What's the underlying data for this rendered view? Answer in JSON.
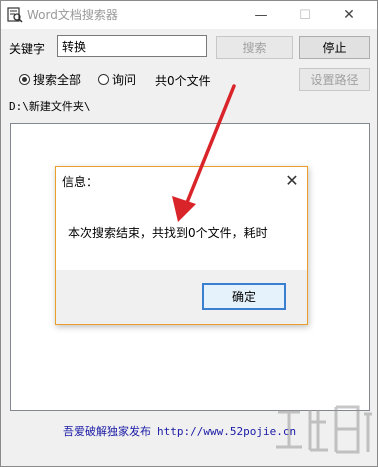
{
  "window": {
    "title": "Word文档搜索器",
    "controls": {
      "minimize": "—",
      "maximize": "☐",
      "close": "✕"
    }
  },
  "search": {
    "keyword_label": "关键字",
    "keyword_value": "转换",
    "search_button": "搜索",
    "stop_button": "停止",
    "set_path_button": "设置路径"
  },
  "options": {
    "search_all": "搜索全部",
    "ask": "询问",
    "selected": "search_all"
  },
  "status": {
    "found_text": "共0个文件",
    "path": "D:\\新建文件夹\\"
  },
  "dialog": {
    "title": "信息：",
    "message": "本次搜索结束，共找到0个文件，耗时",
    "ok_button": "确定"
  },
  "footer": {
    "text": "吾爱破解独家发布",
    "url": "http://www.52pojie.cn"
  },
  "colors": {
    "arrow": "#d9242a",
    "footer_text": "#1a1aa6",
    "dialog_border": "#e8a02a",
    "ok_border": "#3c7fd1"
  }
}
